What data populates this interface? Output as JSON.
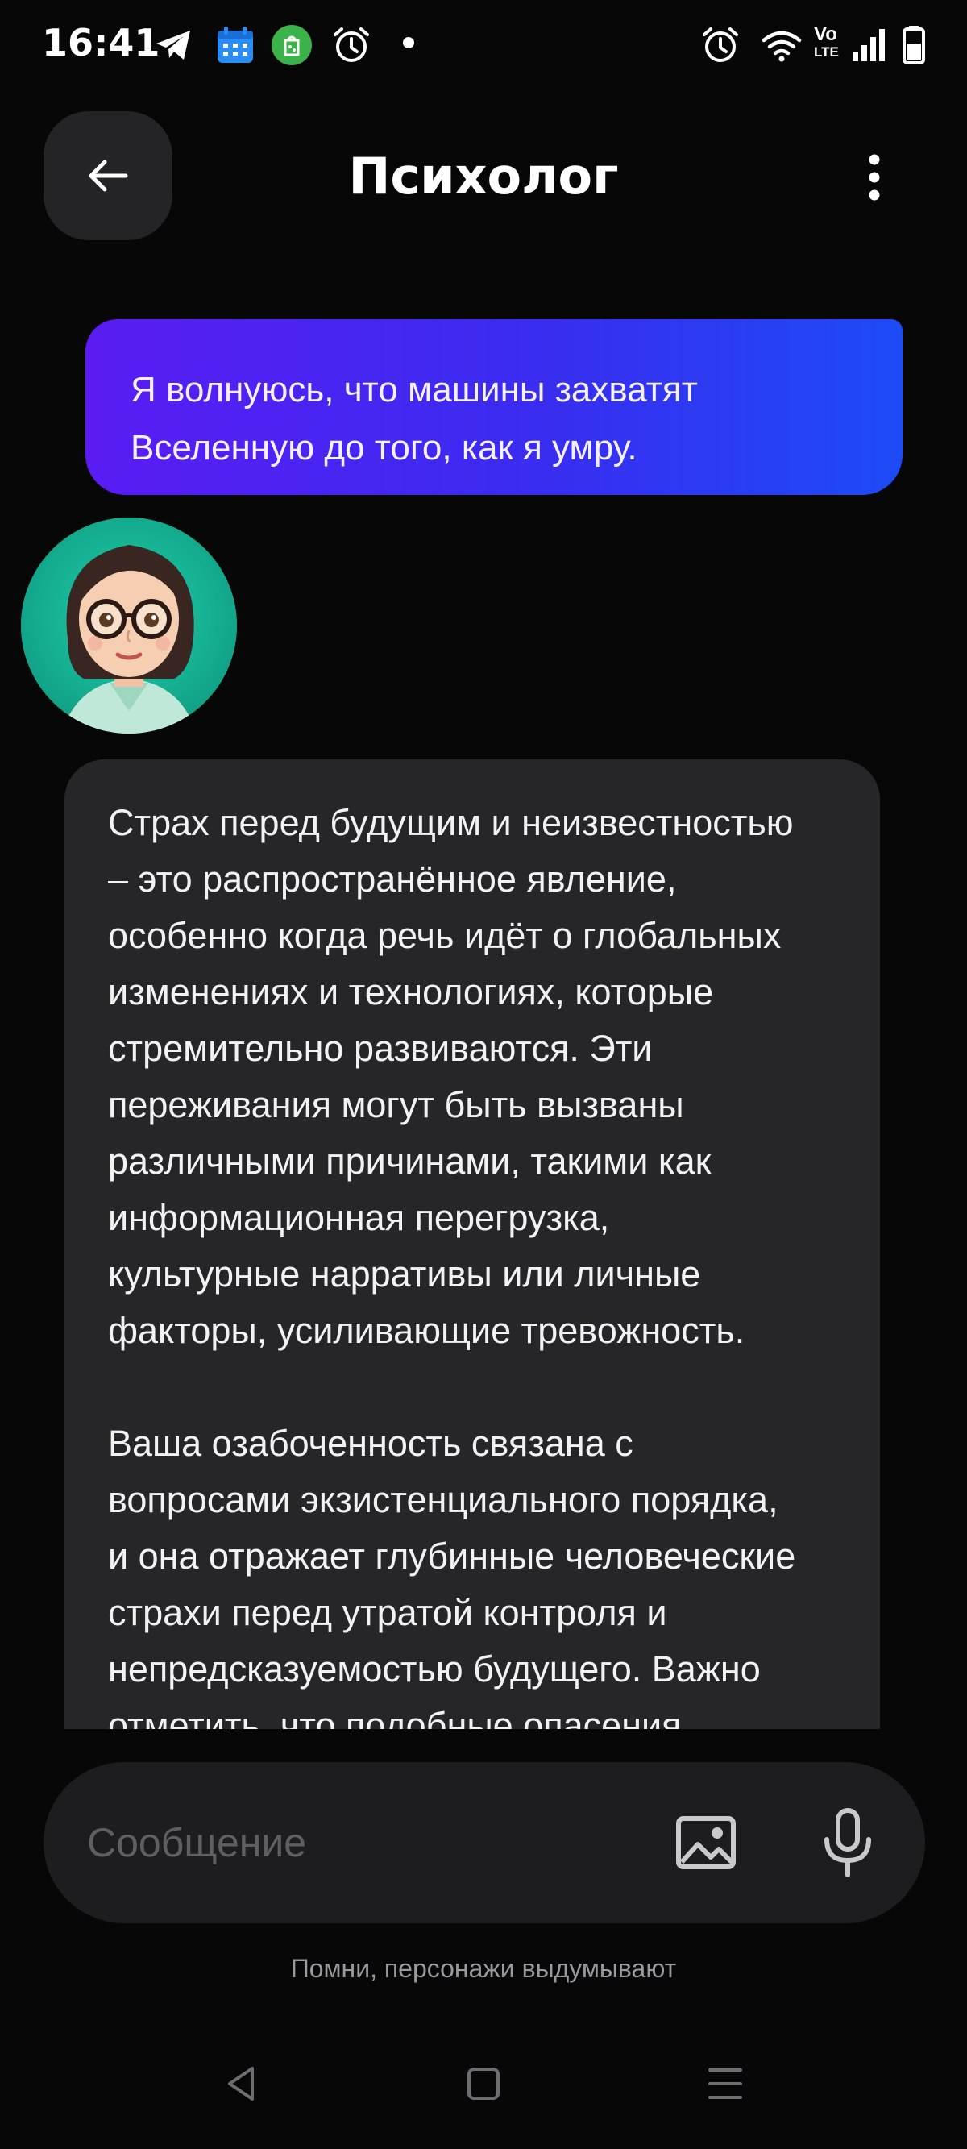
{
  "status_bar": {
    "time": "16:41",
    "left_icons": [
      "telegram-icon",
      "calendar-icon",
      "app-badge-icon",
      "alarm-icon",
      "notification-dot"
    ],
    "right_icons": [
      "alarm-icon",
      "wifi-icon",
      "volte-icon",
      "signal-icon",
      "battery-icon"
    ],
    "volte_top": "Vo",
    "volte_bottom": "LTE"
  },
  "header": {
    "title": "Психолог",
    "back_icon": "arrow-left-icon",
    "menu_icon": "more-vertical-icon"
  },
  "messages": [
    {
      "sender": "user",
      "lines": [
        "Я волнуюсь, что машины захватят",
        "Вселенную до того, как я умру."
      ]
    },
    {
      "sender": "bot",
      "paragraphs": [
        [
          "Страх перед будущим и неизвестностью",
          "– это распространённое явление,",
          "особенно когда речь идёт о глобальных",
          "изменениях и технологиях, которые",
          "стремительно развиваются. Эти",
          "переживания могут быть вызваны",
          "различными причинами, такими как",
          "информационная перегрузка,",
          "культурные нарративы или личные",
          "факторы, усиливающие тревожность."
        ],
        [
          "Ваша озабоченность связана с",
          "вопросами экзистенциального порядка,",
          "и она отражает глубинные человеческие",
          "страхи перед утратой контроля и",
          "непредсказуемостью будущего. Важно",
          "отметить, что подобные опасения"
        ]
      ]
    }
  ],
  "composer": {
    "placeholder": "Сообщение",
    "image_icon": "image-icon",
    "mic_icon": "microphone-icon"
  },
  "disclaimer": "Помни, персонажи выдумывают",
  "nav": [
    "back-triangle-icon",
    "home-square-icon",
    "recents-menu-icon"
  ],
  "colors": {
    "background": "#070708",
    "bot_bubble": "#262628",
    "user_bubble_start": "#5a1cf3",
    "user_bubble_end": "#1d4bf5",
    "avatar_bg": "#15b597"
  }
}
